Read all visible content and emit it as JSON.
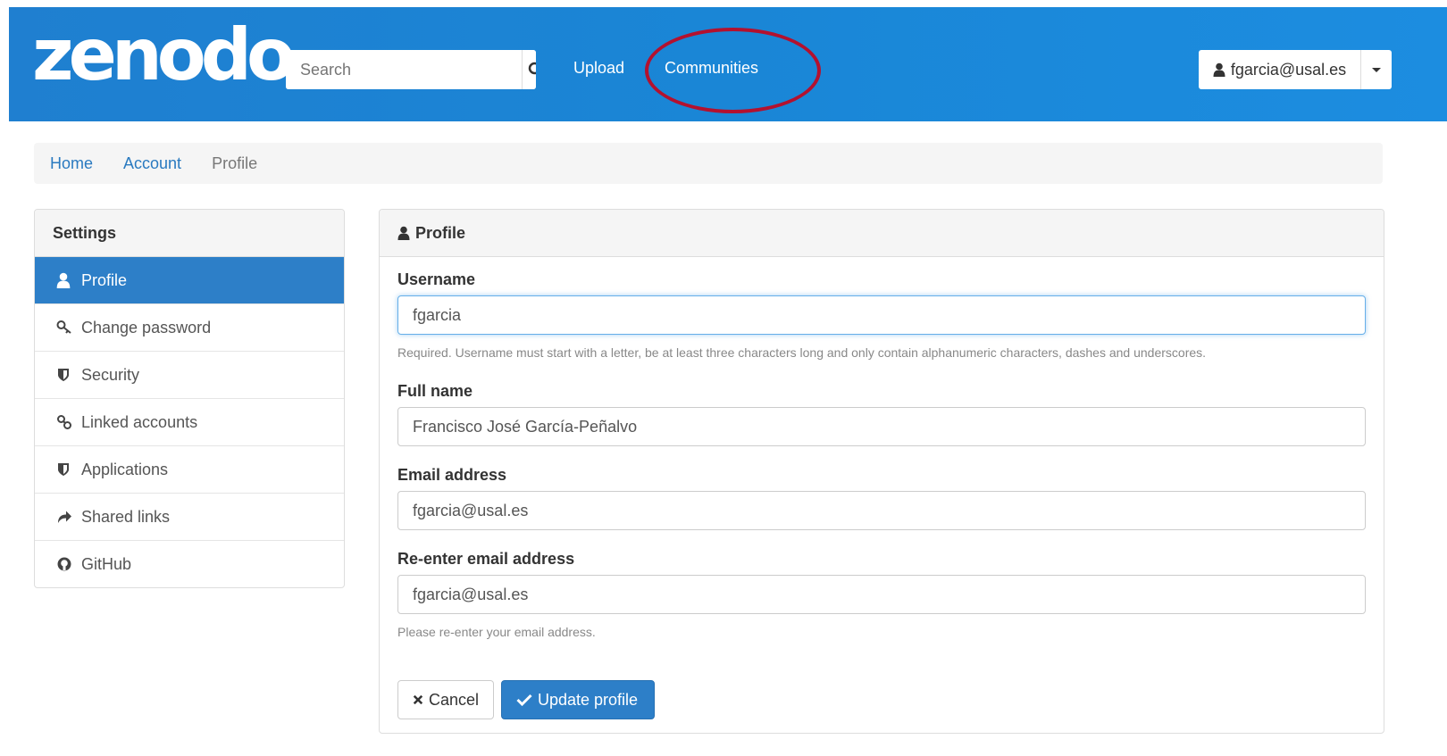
{
  "header": {
    "logo": "zenodo",
    "search_placeholder": "Search",
    "nav": {
      "upload": "Upload",
      "communities": "Communities"
    },
    "user": "fgarcia@usal.es"
  },
  "breadcrumb": {
    "home": "Home",
    "account": "Account",
    "current": "Profile"
  },
  "sidebar": {
    "title": "Settings",
    "items": [
      {
        "label": "Profile",
        "icon": "user-icon",
        "active": true
      },
      {
        "label": "Change password",
        "icon": "key-icon"
      },
      {
        "label": "Security",
        "icon": "shield-icon"
      },
      {
        "label": "Linked accounts",
        "icon": "link-icon"
      },
      {
        "label": "Applications",
        "icon": "shield-icon"
      },
      {
        "label": "Shared links",
        "icon": "share-icon"
      },
      {
        "label": "GitHub",
        "icon": "github-icon"
      }
    ]
  },
  "profile": {
    "title": "Profile",
    "username_label": "Username",
    "username_value": "fgarcia",
    "username_help": "Required. Username must start with a letter, be at least three characters long and only contain alphanumeric characters, dashes and underscores.",
    "fullname_label": "Full name",
    "fullname_value": "Francisco José García-Peñalvo",
    "email_label": "Email address",
    "email_value": "fgarcia@usal.es",
    "reemail_label": "Re-enter email address",
    "reemail_value": "fgarcia@usal.es",
    "reemail_help": "Please re-enter your email address.",
    "cancel": "Cancel",
    "update": "Update profile"
  },
  "colors": {
    "header": "#1a86d6",
    "accent": "#2d7fc8",
    "highlight": "#b3112f"
  }
}
